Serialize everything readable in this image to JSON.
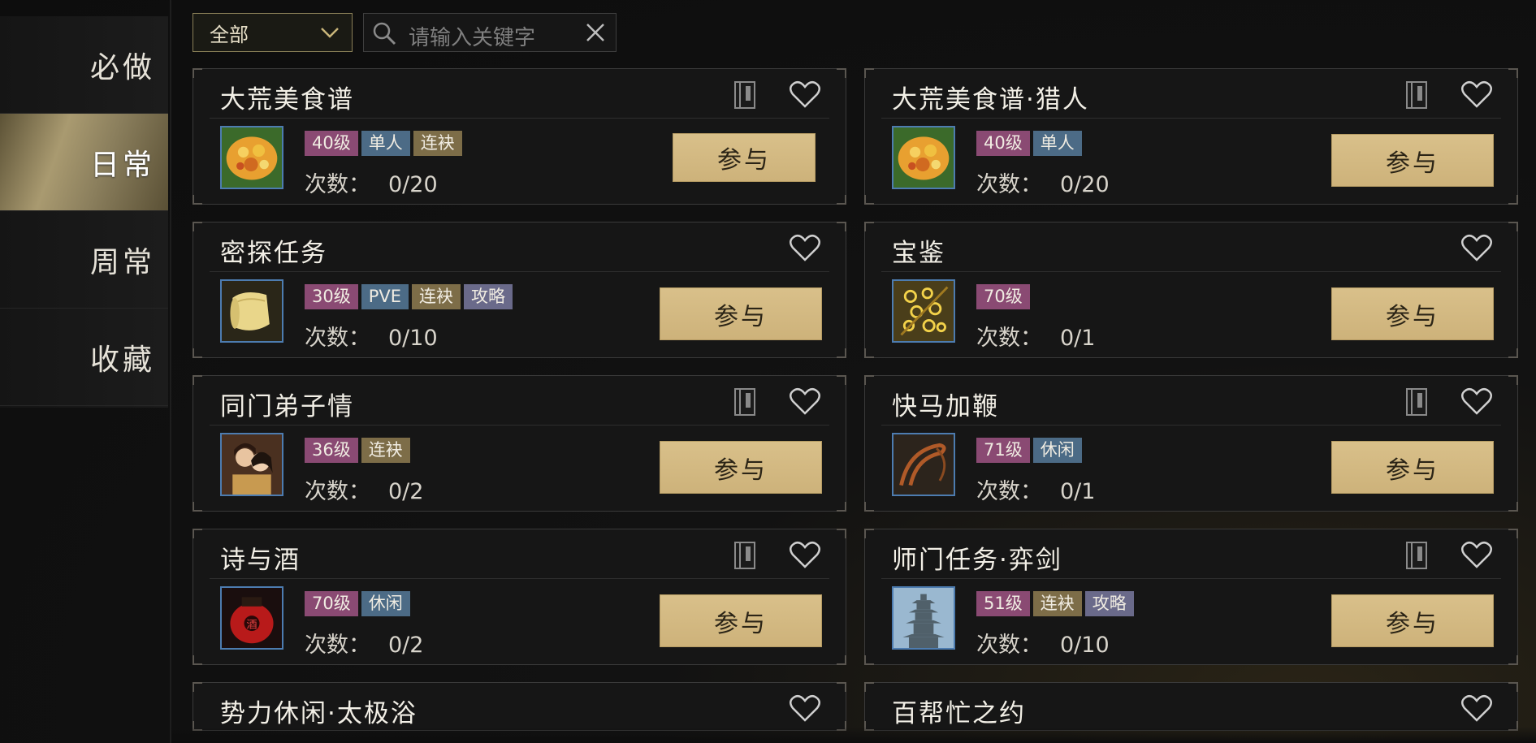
{
  "sidebar": {
    "items": [
      {
        "label": "必做",
        "active": false
      },
      {
        "label": "日常",
        "active": true
      },
      {
        "label": "周常",
        "active": false
      },
      {
        "label": "收藏",
        "active": false
      }
    ]
  },
  "filter": {
    "dropdown_value": "全部",
    "search_placeholder": "请输入关键字"
  },
  "tag_colors": {
    "level": "#8a4a73",
    "type": "#4c6b86",
    "chain": "#7d6d48",
    "guide": "#6a6a8a"
  },
  "count_label": "次数：",
  "cards": [
    {
      "title": "大荒美食谱",
      "icon": "food-dish-icon",
      "tags": [
        "40级",
        "单人",
        "连袂"
      ],
      "count": "0/20",
      "join_label": "参与",
      "has_book": true
    },
    {
      "title": "大荒美食谱·猎人",
      "icon": "food-dish-icon",
      "tags": [
        "40级",
        "单人"
      ],
      "count": "0/20",
      "join_label": "参与",
      "has_book": true
    },
    {
      "title": "密探任务",
      "icon": "scroll-icon",
      "tags": [
        "30级",
        "PVE",
        "连袂",
        "攻略"
      ],
      "count": "0/10",
      "join_label": "参与",
      "has_book": false
    },
    {
      "title": "宝鉴",
      "icon": "coins-icon",
      "tags": [
        "70级"
      ],
      "count": "0/1",
      "join_label": "参与",
      "has_book": false
    },
    {
      "title": "同门弟子情",
      "icon": "couple-portrait-icon",
      "tags": [
        "36级",
        "连袂"
      ],
      "count": "0/2",
      "join_label": "参与",
      "has_book": true
    },
    {
      "title": "快马加鞭",
      "icon": "whip-icon",
      "tags": [
        "71级",
        "休闲"
      ],
      "count": "0/1",
      "join_label": "参与",
      "has_book": true
    },
    {
      "title": "诗与酒",
      "icon": "wine-jar-icon",
      "tags": [
        "70级",
        "休闲"
      ],
      "count": "0/2",
      "join_label": "参与",
      "has_book": true
    },
    {
      "title": "师门任务·弈剑",
      "icon": "pagoda-icon",
      "tags": [
        "51级",
        "连袂",
        "攻略"
      ],
      "count": "0/10",
      "join_label": "参与",
      "has_book": true
    },
    {
      "title": "势力休闲·太极浴",
      "partial": true
    },
    {
      "title": "百帮忙之约",
      "partial": true
    }
  ]
}
